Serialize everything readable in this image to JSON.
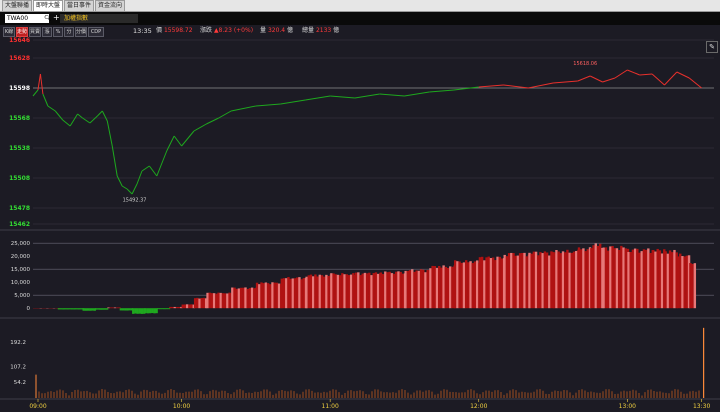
{
  "tabs": [
    "大盤聯播",
    "即時大盤",
    "當日事件",
    "資金流向"
  ],
  "active_tab": 1,
  "search": {
    "symbol": "TWA00",
    "index_name": "加權指數"
  },
  "toolbar": {
    "buttons": [
      "K線",
      "走勢",
      "買賣",
      "漲",
      "%",
      "分",
      "分價",
      "CDP"
    ],
    "active_button": 1
  },
  "quote": {
    "time": "13:35",
    "price_label": "價",
    "price": "15598.72",
    "change_label": "漲跌",
    "change": "▲8.23 (+0%)",
    "volume_label": "量",
    "volume": "320.4",
    "volume_unit": "億",
    "total_label": "總量",
    "total": "2133",
    "total_unit": "億"
  },
  "colors": {
    "up": "#e8302c",
    "down": "#1ea81e",
    "grid": "#3a3945",
    "bg": "#1c1b24"
  },
  "chart_data": [
    {
      "type": "line",
      "y_ticks": [
        "15646",
        "15628",
        "15598",
        "15568",
        "15538",
        "15508",
        "15478",
        "15462"
      ],
      "reference": 15598,
      "ylim": [
        15462,
        15646
      ],
      "annotations": [
        {
          "text": "15492.37",
          "value": 15492.37,
          "time": "09:41"
        },
        {
          "text": "15618.06",
          "value": 15618.06,
          "time": "12:43"
        }
      ],
      "x": [
        "09:00",
        "09:02",
        "09:03",
        "09:04",
        "09:06",
        "09:09",
        "09:12",
        "09:15",
        "09:18",
        "09:20",
        "09:23",
        "09:26",
        "09:28",
        "09:30",
        "09:32",
        "09:34",
        "09:36",
        "09:38",
        "09:40",
        "09:42",
        "09:44",
        "09:47",
        "09:50",
        "09:54",
        "09:57",
        "10:00",
        "10:05",
        "10:10",
        "10:15",
        "10:20",
        "10:30",
        "10:40",
        "10:50",
        "11:00",
        "11:10",
        "11:20",
        "11:30",
        "11:40",
        "11:50",
        "12:00",
        "12:10",
        "12:20",
        "12:30",
        "12:40",
        "12:45",
        "12:50",
        "12:55",
        "13:00",
        "13:05",
        "13:10",
        "13:15",
        "13:20",
        "13:25",
        "13:30"
      ],
      "values": [
        15590,
        15596,
        15612,
        15592,
        15580,
        15575,
        15566,
        15560,
        15572,
        15568,
        15563,
        15570,
        15575,
        15565,
        15540,
        15510,
        15500,
        15497,
        15492,
        15502,
        15515,
        15520,
        15510,
        15535,
        15550,
        15540,
        15555,
        15562,
        15568,
        15575,
        15580,
        15582,
        15586,
        15590,
        15588,
        15592,
        15590,
        15594,
        15596,
        15599,
        15601,
        15598,
        15603,
        15605,
        15610,
        15604,
        15608,
        15616,
        15611,
        15612,
        15601,
        15614,
        15608,
        15598
      ]
    },
    {
      "type": "area",
      "y_ticks": [
        "25,000",
        "20,000",
        "15,000",
        "10,000",
        "5,000",
        "0"
      ],
      "ylim": [
        -3000,
        27000
      ],
      "x": [
        "09:00",
        "09:10",
        "09:20",
        "09:25",
        "09:30",
        "09:35",
        "09:40",
        "09:45",
        "09:50",
        "09:55",
        "10:00",
        "10:05",
        "10:10",
        "10:20",
        "10:30",
        "10:40",
        "10:50",
        "11:00",
        "11:10",
        "11:20",
        "11:30",
        "11:40",
        "11:50",
        "12:00",
        "12:10",
        "12:20",
        "12:30",
        "12:40",
        "12:45",
        "12:50",
        "13:00",
        "13:10",
        "13:15",
        "13:20",
        "13:25"
      ],
      "values": [
        0,
        -500,
        -1000,
        -600,
        300,
        -900,
        -2200,
        -2000,
        -400,
        500,
        1500,
        4000,
        6000,
        8000,
        10000,
        12000,
        13000,
        13500,
        13800,
        14200,
        15000,
        16500,
        18500,
        20000,
        21500,
        22000,
        22500,
        23500,
        25000,
        24000,
        23000,
        22800,
        22500,
        21000,
        18000
      ]
    },
    {
      "type": "bar",
      "y_ticks": [
        "192.2",
        "107.2",
        "54.2"
      ],
      "ylim": [
        0,
        260
      ],
      "x": [
        "09:00",
        "13:30"
      ],
      "values": [
        80,
        240
      ]
    }
  ],
  "x_axis": [
    "09:00",
    "10:00",
    "11:00",
    "12:00",
    "13:00",
    "13:30"
  ]
}
